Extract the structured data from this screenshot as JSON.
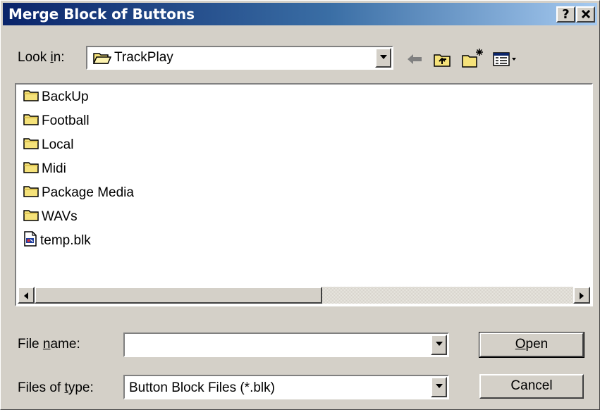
{
  "dialog": {
    "title": "Merge Block of Buttons",
    "help_label": "?",
    "close_label": "✕"
  },
  "look_in": {
    "label_pre": "Look ",
    "label_accel": "i",
    "label_post": "n:",
    "value": "TrackPlay"
  },
  "toolbar": {
    "icons": [
      "back-arrow-icon",
      "up-one-level-icon",
      "create-new-folder-icon",
      "view-menu-icon"
    ]
  },
  "file_list": {
    "items": [
      {
        "name": "BackUp",
        "icon": "folder-icon"
      },
      {
        "name": "Football",
        "icon": "folder-icon"
      },
      {
        "name": "Local",
        "icon": "folder-icon"
      },
      {
        "name": "Midi",
        "icon": "folder-icon"
      },
      {
        "name": "Package Media",
        "icon": "folder-icon"
      },
      {
        "name": "WAVs",
        "icon": "folder-icon"
      },
      {
        "name": "temp.blk",
        "icon": "blk-file-icon"
      }
    ]
  },
  "file_name": {
    "label_pre": "File ",
    "label_accel": "n",
    "label_post": "ame:",
    "value": ""
  },
  "file_type": {
    "label_pre": "Files of ",
    "label_accel": "t",
    "label_post": "ype:",
    "value": "Button Block Files (*.blk)"
  },
  "buttons": {
    "open_accel": "O",
    "open_rest": "pen",
    "cancel": "Cancel"
  },
  "colors": {
    "title_gradient_start": "#0a246a",
    "title_gradient_end": "#a6caf0",
    "face": "#d4d0c8",
    "folder": "#f5e27a"
  }
}
